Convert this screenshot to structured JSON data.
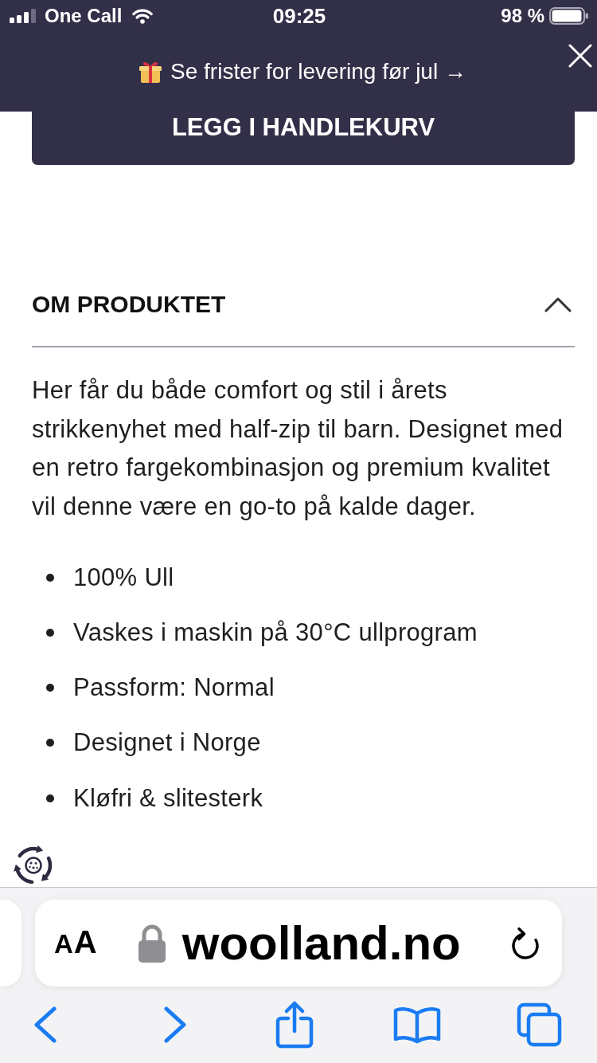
{
  "status_bar": {
    "carrier": "One Call",
    "time": "09:25",
    "battery": "98 %"
  },
  "promo_banner": {
    "text": "Se frister for levering før jul →"
  },
  "cart_button": {
    "label": "LEGG I HANDLEKURV"
  },
  "product_info": {
    "heading": "OM PRODUKTET",
    "expanded": true,
    "description": "Her får du både comfort og stil i årets strikkenyhet med half-zip til barn. Designet med en retro fargekombinasjon og premium kvalitet vil denne være en go-to på kalde dager.",
    "features": [
      "100% Ull",
      "Vaskes i maskin på 30°C ullprogram",
      "Passform: Normal",
      "Designet i Norge",
      "Kløfri & slitesterk"
    ]
  },
  "browser": {
    "text_size_button": "AA",
    "url": "woolland.no"
  }
}
